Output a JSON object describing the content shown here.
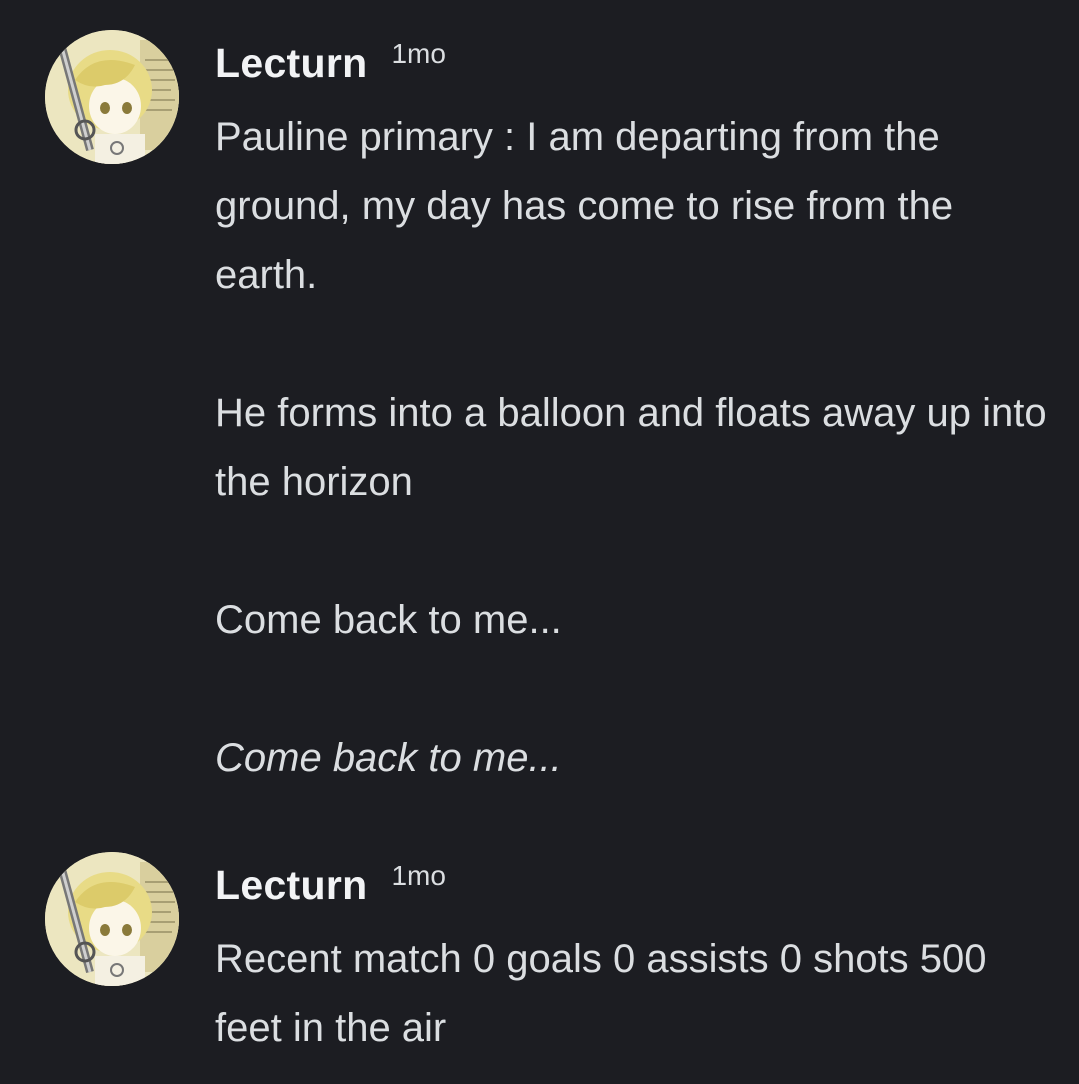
{
  "messages": [
    {
      "author": "Lecturn",
      "timestamp": "1mo",
      "avatar_icon": "anime-character-avatar-icon",
      "paragraphs": [
        {
          "text": "Pauline primary : I am departing from the ground, my day has come to rise from the earth.",
          "italic": false
        },
        {
          "text": "He forms into a balloon and floats away up into the horizon",
          "italic": false
        },
        {
          "text": "Come back to me...",
          "italic": false
        },
        {
          "text": "Come back to me...",
          "italic": true
        }
      ]
    },
    {
      "author": "Lecturn",
      "timestamp": "1mo",
      "avatar_icon": "anime-character-avatar-icon",
      "paragraphs": [
        {
          "text": "Recent match 0 goals 0 assists 0 shots  500 feet in the air",
          "italic": false
        }
      ]
    }
  ],
  "colors": {
    "background": "#1c1d22",
    "author": "#f2f3f5",
    "text": "#dbdee1"
  }
}
